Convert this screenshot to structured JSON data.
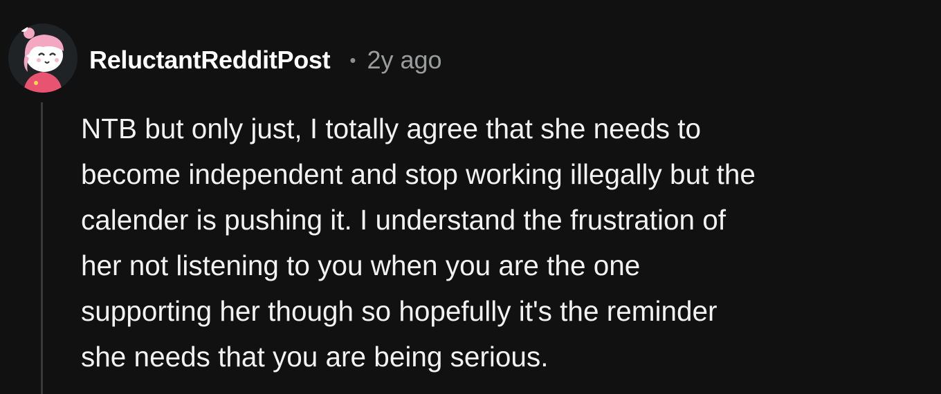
{
  "comment": {
    "author": "ReluctantRedditPost",
    "separator": "•",
    "timestamp": "2y ago",
    "avatar_icon": "snoo-avatar-icon",
    "body_lines": [
      "NTB but only just, I totally agree that she needs to",
      "become independent and stop working illegally but the",
      "calender is pushing it. I understand the frustration of",
      "her not listening to you when you are the one",
      "supporting her though so hopefully it's the reminder",
      "she needs that you are being serious."
    ]
  },
  "colors": {
    "background": "#111111",
    "text": "#f2f2f2",
    "muted": "#9a9c9e",
    "thread_line": "#3a3a3a",
    "avatar_hair": "#f4a7c0",
    "avatar_shirt": "#e8546f"
  }
}
